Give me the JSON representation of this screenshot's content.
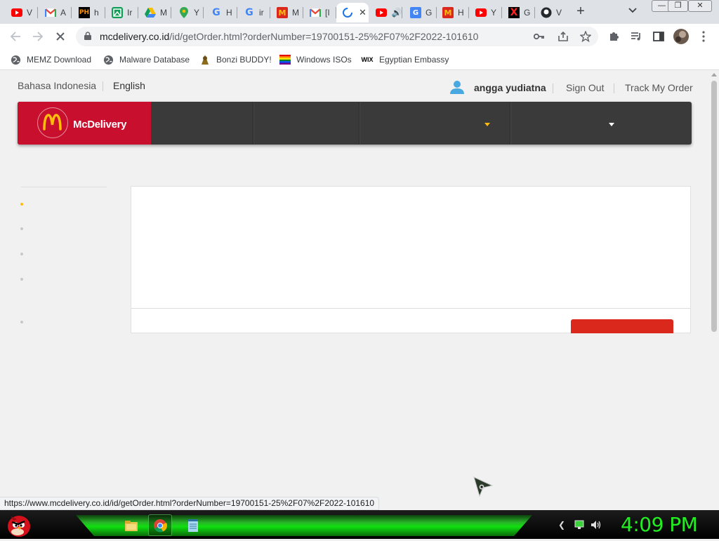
{
  "tabs": [
    {
      "title": "V",
      "icon": "youtube-icon",
      "color": "#ff0000"
    },
    {
      "title": "A",
      "icon": "gmail-icon",
      "color": "#ea4335"
    },
    {
      "title": "h",
      "icon": "pornhub-icon",
      "color": "#ff9000"
    },
    {
      "title": "Ir",
      "icon": "image-editor-icon",
      "color": "#0f9d58"
    },
    {
      "title": "M",
      "icon": "google-drive-icon",
      "color": "#fbbc04"
    },
    {
      "title": "Y",
      "icon": "google-maps-icon",
      "color": "#34a853"
    },
    {
      "title": "H",
      "icon": "google-icon",
      "color": "#4285f4"
    },
    {
      "title": "ir",
      "icon": "google-icon",
      "color": "#4285f4"
    },
    {
      "title": "M",
      "icon": "mcdonalds-icon",
      "color": "#da291c"
    },
    {
      "title": "[I",
      "icon": "gmail-icon",
      "color": "#ea4335"
    },
    {
      "title": "",
      "icon": "loading-spinner-icon",
      "color": "#1a73e8",
      "active": true
    },
    {
      "title": "",
      "icon": "youtube-audio-icon",
      "color": "#ff0000"
    },
    {
      "title": "G",
      "icon": "google-translate-icon",
      "color": "#4285f4"
    },
    {
      "title": "H",
      "icon": "mcdonalds-icon",
      "color": "#da291c"
    },
    {
      "title": "Y",
      "icon": "youtube-icon",
      "color": "#ff0000"
    },
    {
      "title": "G",
      "icon": "x-twitter-icon",
      "color": "#000000"
    },
    {
      "title": "V",
      "icon": "github-icon",
      "color": "#24292e"
    }
  ],
  "window_buttons": {
    "minimize": "—",
    "maximize": "❐",
    "close": "✕"
  },
  "url": {
    "host": "mcdelivery.co.id",
    "path": "/id/getOrder.html?orderNumber=19700151-25%2F07%2F2022-101610"
  },
  "bookmarks": [
    {
      "label": "MEMZ Download",
      "icon": "globe-icon"
    },
    {
      "label": "Malware Database",
      "icon": "globe-icon"
    },
    {
      "label": "Bonzi BUDDY!",
      "icon": "bonzi-icon"
    },
    {
      "label": "Windows ISOs",
      "icon": "rainbow-flag-icon"
    },
    {
      "label": "Egyptian Embassy",
      "icon": "wix-icon"
    }
  ],
  "site": {
    "lang_id": "Bahasa Indonesia",
    "lang_en": "English",
    "user_name": "angga yudiatna",
    "sign_out": "Sign Out",
    "track_order": "Track My Order",
    "brand": "McDelivery",
    "brand_logo": "M"
  },
  "status_url": "https://www.mcdelivery.co.id/id/getOrder.html?orderNumber=19700151-25%2F07%2F2022-101610",
  "taskbar": {
    "clock": "4:09 PM"
  },
  "colors": {
    "mcd_red": "#c8102e",
    "mcd_yellow": "#ffbc0d",
    "nav_dark": "#3a3a3a",
    "clock_green": "#22ee22"
  }
}
